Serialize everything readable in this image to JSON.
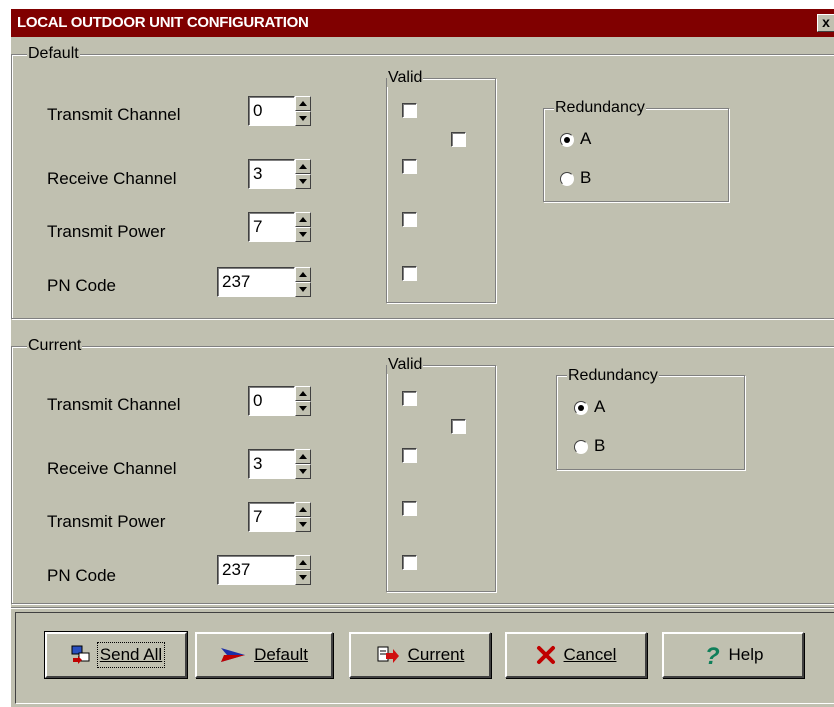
{
  "window": {
    "title": "LOCAL OUTDOOR UNIT CONFIGURATION",
    "close_label": "x"
  },
  "default_section": {
    "legend": "Default",
    "valid_legend": "Valid",
    "fields": [
      {
        "label": "Transmit Channel",
        "value": "0"
      },
      {
        "label": "Receive Channel",
        "value": "3"
      },
      {
        "label": "Transmit Power",
        "value": "7"
      },
      {
        "label": "PN Code",
        "value": "237"
      }
    ],
    "valid_checks": [
      false,
      false,
      false,
      false,
      false
    ],
    "redundancy": {
      "legend": "Redundancy",
      "options": [
        {
          "label": "A",
          "selected": true
        },
        {
          "label": "B",
          "selected": false
        }
      ]
    }
  },
  "current_section": {
    "legend": "Current",
    "valid_legend": "Valid",
    "fields": [
      {
        "label": "Transmit Channel",
        "value": "0"
      },
      {
        "label": "Receive Channel",
        "value": "3"
      },
      {
        "label": "Transmit Power",
        "value": "7"
      },
      {
        "label": "PN Code",
        "value": "237"
      }
    ],
    "valid_checks": [
      false,
      false,
      false,
      false,
      false
    ],
    "redundancy": {
      "legend": "Redundancy",
      "options": [
        {
          "label": "A",
          "selected": true
        },
        {
          "label": "B",
          "selected": false
        }
      ]
    }
  },
  "buttons": {
    "send_all": {
      "label": "Send All",
      "icon": "send-all-icon"
    },
    "default": {
      "label": "Default",
      "icon": "arrow-right-icon"
    },
    "current": {
      "label": "Current",
      "icon": "document-arrow-icon"
    },
    "cancel": {
      "label": "Cancel",
      "icon": "red-x-icon"
    },
    "help": {
      "label": "Help",
      "icon": "question-mark-icon"
    }
  },
  "colors": {
    "titlebar": "#800000",
    "face": "#c0c0b0"
  }
}
